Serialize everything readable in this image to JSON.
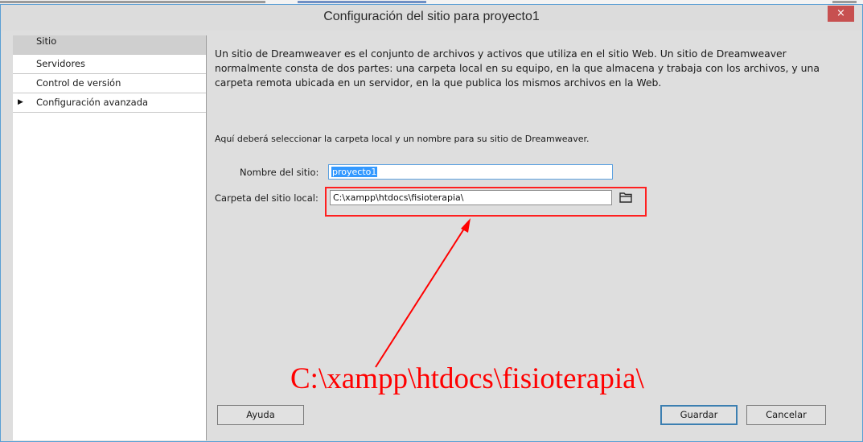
{
  "dialog": {
    "title": "Configuración del sitio para proyecto1",
    "close_glyph": "×"
  },
  "sidebar": {
    "items": [
      {
        "label": "Sitio",
        "selected": true
      },
      {
        "label": "Servidores",
        "selected": false
      },
      {
        "label": "Control de versión",
        "selected": false
      },
      {
        "label": "Configuración avanzada",
        "selected": false,
        "expandable": true
      }
    ],
    "expand_glyph": "▶"
  },
  "main": {
    "description": "Un sitio de Dreamweaver es el conjunto de archivos y activos que utiliza en el sitio Web. Un sitio de Dreamweaver normalmente consta de dos partes: una carpeta local en su equipo, en la que almacena y trabaja con los archivos, y una carpeta remota ubicada en un servidor, en la que publica los mismos archivos en la Web.",
    "prompt": "Aquí deberá seleccionar la carpeta local y un nombre para su sitio de Dreamweaver.",
    "site_name_label": "Nombre del sitio:",
    "site_name_value": "proyecto1",
    "local_folder_label": "Carpeta del sitio local:",
    "local_folder_value": "C:\\xampp\\htdocs\\fisioterapia\\",
    "folder_icon": "folder-icon"
  },
  "annotation": {
    "text": "C:\\xampp\\htdocs\\fisioterapia\\",
    "color": "#ff0000"
  },
  "buttons": {
    "help": "Ayuda",
    "save": "Guardar",
    "cancel": "Cancelar"
  },
  "colors": {
    "close_button": "#c75050",
    "selection": "#3399ff",
    "annotation": "#ff0000",
    "dialog_border": "#5a9fd4"
  }
}
